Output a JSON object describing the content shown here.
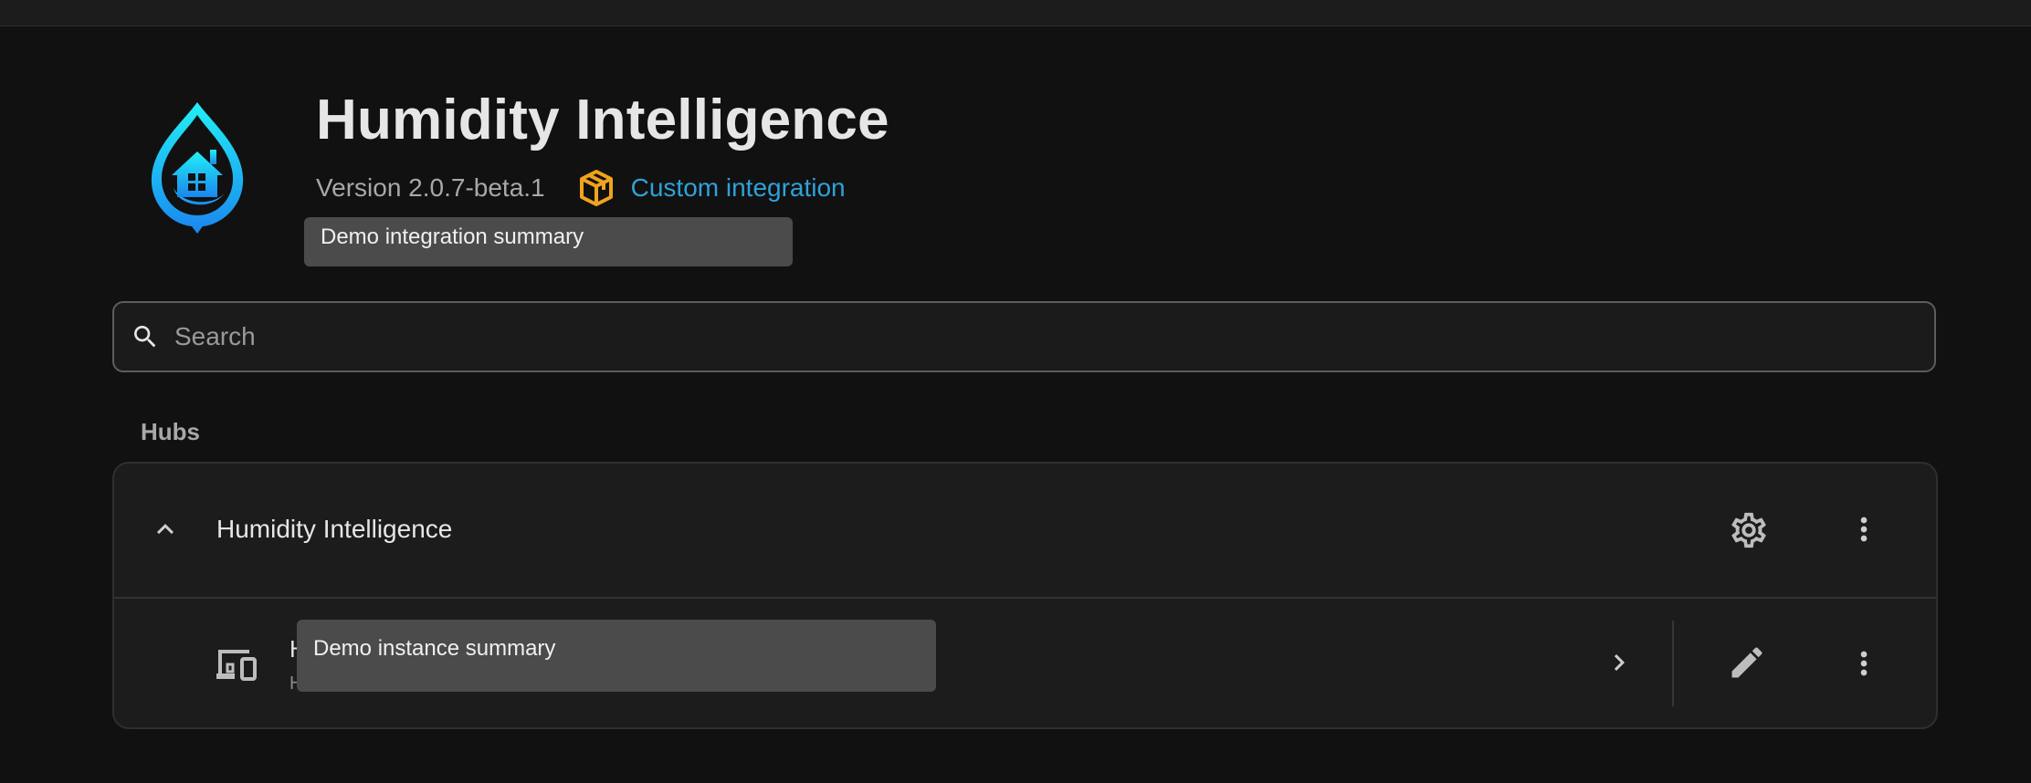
{
  "integration": {
    "title": "Humidity Intelligence",
    "version": "Version 2.0.7-beta.1",
    "custom_label": "Custom integration",
    "summary_tooltip": "Demo integration summary"
  },
  "search": {
    "placeholder": "Search",
    "value": ""
  },
  "hubs": {
    "section_label": "Hubs",
    "hub_title": "Humidity Intelligence",
    "entry": {
      "title": "H",
      "subtitle": "H",
      "tooltip": "Demo instance summary"
    }
  },
  "icons": {
    "logo": "humidity-intelligence-logo",
    "package": "package-icon",
    "search": "search-icon",
    "collapse": "chevron-up-icon",
    "settings": "gear-icon",
    "menu": "dots-vertical-icon",
    "device": "devices-icon",
    "navigate": "chevron-right-icon",
    "edit": "pencil-icon"
  },
  "colors": {
    "background": "#111111",
    "card": "#1c1c1c",
    "tooltip": "#4b4b4b",
    "link": "#2ea2d8",
    "custom_badge": "#f0a31c",
    "logo_top": "#1fe3f2",
    "logo_bottom": "#1a8cf0"
  }
}
